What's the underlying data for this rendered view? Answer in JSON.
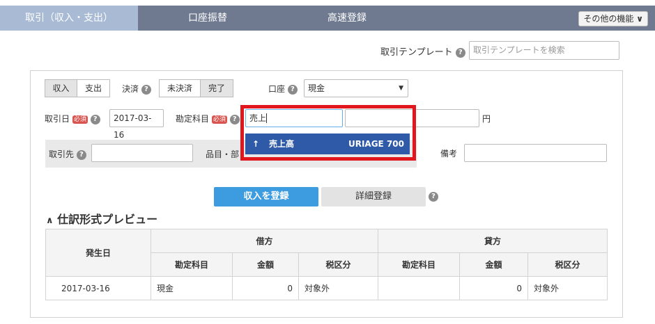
{
  "tabs": [
    {
      "label": "取引（収入・支出）",
      "active": true
    },
    {
      "label": "口座振替",
      "active": false
    },
    {
      "label": "高速登録",
      "active": false
    }
  ],
  "more_button": {
    "label": "その他の機能",
    "icon": "chevron-down-icon"
  },
  "template": {
    "label": "取引テンプレート",
    "placeholder": "取引テンプレートを検索"
  },
  "form": {
    "type_options": [
      "収入",
      "支出"
    ],
    "type_selected": "収入",
    "settlement_label": "決済",
    "settlement_options": [
      "未決済",
      "完了"
    ],
    "settlement_selected": "完了",
    "account_label": "口座",
    "account_value": "現金",
    "date_label": "取引日",
    "required_badge": "必須",
    "date_value": "2017-03-16",
    "subject_label": "勘定科目",
    "subject_value": "売上",
    "amount_value": "",
    "currency": "円",
    "partner_label": "取引先",
    "item_label": "品目・部",
    "memo_label": "備考",
    "suggestion": {
      "name": "売上高",
      "code": "URIAGE",
      "number": "700"
    }
  },
  "buttons": {
    "register": "収入を登録",
    "detail": "詳細登録"
  },
  "preview": {
    "title": "仕訳形式プレビュー",
    "col_date": "発生日",
    "debit": "借方",
    "credit": "貸方",
    "sub_headers": [
      "勘定科目",
      "金額",
      "税区分"
    ],
    "row": {
      "date": "2017-03-16",
      "debit_subject": "現金",
      "debit_amount": "0",
      "debit_tax": "対象外",
      "credit_subject": "",
      "credit_amount": "0",
      "credit_tax": "対象外"
    }
  },
  "colors": {
    "tab_bar": "#6f7a90",
    "tab_active": "#a8bad4",
    "primary": "#3d9be0",
    "suggest_bg": "#2e5aa8",
    "highlight": "#e2171e"
  }
}
